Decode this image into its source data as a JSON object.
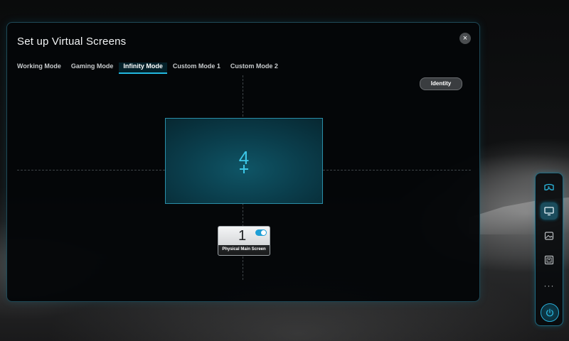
{
  "dialog": {
    "title": "Set up Virtual Screens",
    "close_icon": "×",
    "tabs": [
      {
        "label": "Working Mode",
        "active": false
      },
      {
        "label": "Gaming Mode",
        "active": false
      },
      {
        "label": "Infinity Mode",
        "active": true
      },
      {
        "label": "Custom Mode 1",
        "active": false
      },
      {
        "label": "Custom Mode 2",
        "active": false
      }
    ],
    "identity_label": "Identity"
  },
  "canvas": {
    "virtual_screen": {
      "number": "4"
    },
    "physical_screen": {
      "number": "1",
      "label": "Physical Main Screen",
      "toggle_on": true
    }
  },
  "dock": {
    "items": [
      {
        "icon": "vr-headset-icon",
        "active": false
      },
      {
        "icon": "monitor-icon",
        "active": true
      },
      {
        "icon": "image-icon",
        "active": false
      },
      {
        "icon": "portrait-frame-icon",
        "active": false
      },
      {
        "icon": "more-icon",
        "text": "···",
        "active": false
      }
    ],
    "power": {
      "icon": "power-icon"
    }
  },
  "colors": {
    "accent": "#22b8e0",
    "virtual_screen_fill": "#0a3c4a",
    "dialog_border": "#1f4a58",
    "toggle_on": "#1f9fd6"
  }
}
